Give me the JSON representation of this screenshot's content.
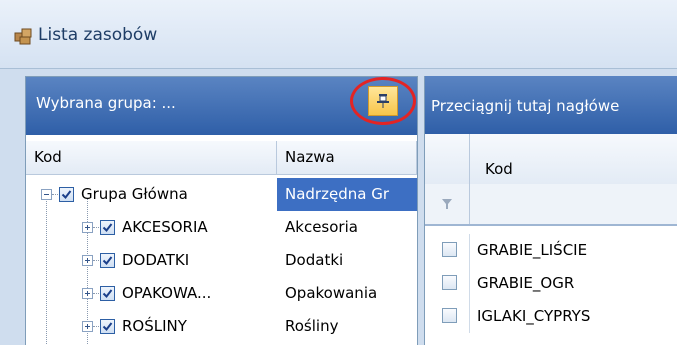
{
  "window": {
    "title": "Lista zasobów",
    "title_icon": "resources-icon"
  },
  "left_panel": {
    "header_label": "Wybrana grupa: ...",
    "pin_icon": "pin-icon",
    "columns": [
      "Kod",
      "Nazwa"
    ],
    "rows": [
      {
        "kod": "Grupa Główna",
        "nazwa": "Nadrzędna Gr",
        "checked": true,
        "expander": "minus",
        "selected": true
      },
      {
        "kod": "AKCESORIA",
        "nazwa": "Akcesoria",
        "checked": true,
        "expander": "plus",
        "selected": false
      },
      {
        "kod": "DODATKI",
        "nazwa": "Dodatki",
        "checked": true,
        "expander": "plus",
        "selected": false
      },
      {
        "kod": "OPAKOWA...",
        "nazwa": "Opakowania",
        "checked": true,
        "expander": "plus",
        "selected": false
      },
      {
        "kod": "ROŚLINY",
        "nazwa": "Rośliny",
        "checked": true,
        "expander": "plus",
        "selected": false
      }
    ]
  },
  "right_panel": {
    "group_hint": "Przeciągnij tutaj nagłówe",
    "column_kod": "Kod",
    "filter_icon": "filter-icon",
    "rows": [
      "GRABIE_LIŚCIE",
      "GRABIE_OGR",
      "IGLAKI_CYPRYS"
    ]
  },
  "colors": {
    "header_blue": "#2f5fa8",
    "selection_blue": "#3d6fc3",
    "pin_yellow": "#f8c54a",
    "highlight_red": "#e32424"
  }
}
